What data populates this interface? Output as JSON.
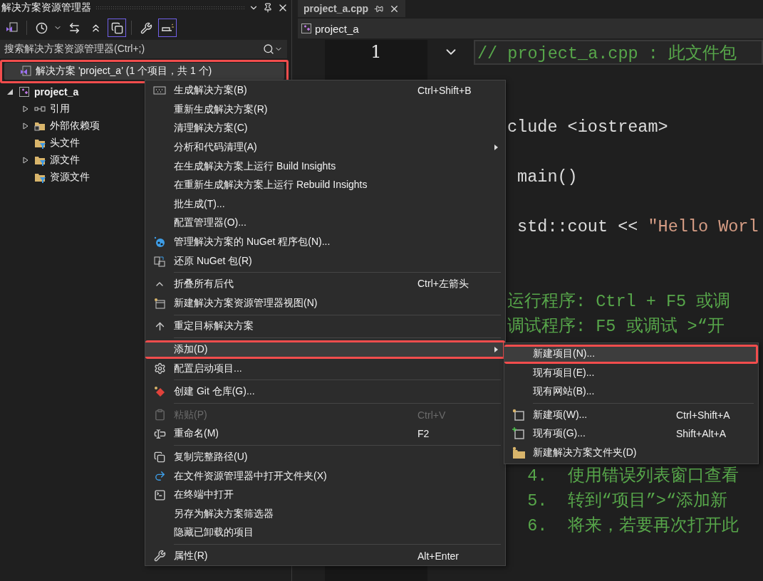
{
  "explorer": {
    "title": "解决方案资源管理器",
    "toolbar": [
      {
        "on": false
      },
      {
        "on": false
      },
      {
        "on": false
      },
      {
        "on": false
      },
      {
        "on": true
      },
      {
        "on": false
      },
      {
        "on": true
      }
    ],
    "search": {
      "placeholder": "搜索解决方案资源管理器(Ctrl+;)"
    },
    "tree": [
      {
        "label": "解决方案 'project_a' (1 个项目，共 1 个)",
        "kind": "solution",
        "selected": true,
        "highlighted": true,
        "children": [
          {
            "label": "project_a",
            "kind": "project",
            "selected": false,
            "highlighted": false,
            "expandable": true,
            "expanded": true,
            "children": [
              {
                "label": "引用",
                "kind": "references",
                "selected": false,
                "highlighted": false,
                "expandable": true,
                "expanded": false
              },
              {
                "label": "外部依赖项",
                "kind": "dependencies",
                "selected": false,
                "highlighted": false,
                "expandable": true,
                "expanded": false
              },
              {
                "label": "头文件",
                "kind": "filter",
                "selected": false,
                "highlighted": false,
                "expandable": false
              },
              {
                "label": "源文件",
                "kind": "filter",
                "selected": false,
                "highlighted": false,
                "expandable": true,
                "expanded": false
              },
              {
                "label": "资源文件",
                "kind": "filter",
                "selected": false,
                "highlighted": false,
                "expandable": false
              }
            ]
          }
        ]
      }
    ]
  },
  "editor": {
    "tab": {
      "label": "project_a.cpp",
      "selected": true
    },
    "nav": {
      "label": "project_a"
    },
    "line_numbers": [
      "1"
    ],
    "lines": [
      {
        "kind": "comment",
        "clipped_left": false,
        "segments": [
          {
            "kind": "comment",
            "text": "// project_a.cpp : 此文件包"
          }
        ]
      },
      {
        "kind": "covered"
      },
      {
        "kind": "blank"
      },
      {
        "kind": "code",
        "clipped_left": true,
        "segments": [
          {
            "kind": "plain",
            "text": "clude <iostream>"
          }
        ]
      },
      {
        "kind": "blank"
      },
      {
        "kind": "code",
        "clipped_left": true,
        "segments": [
          {
            "kind": "plain",
            "text": " main()"
          }
        ]
      },
      {
        "kind": "blank"
      },
      {
        "kind": "code",
        "clipped_left": true,
        "segments": [
          {
            "kind": "plain",
            "text": " std::cout << "
          },
          {
            "kind": "string",
            "text": "\"Hello Worl"
          }
        ]
      },
      {
        "kind": "blank"
      },
      {
        "kind": "blank"
      },
      {
        "kind": "code",
        "clipped_left": true,
        "segments": [
          {
            "kind": "comment",
            "text": "运行程序: Ctrl + F5 或调"
          }
        ]
      },
      {
        "kind": "code",
        "clipped_left": true,
        "segments": [
          {
            "kind": "comment",
            "text": "调试程序: F5 或调试 >“开"
          }
        ]
      },
      {
        "kind": "covered"
      },
      {
        "kind": "covered"
      },
      {
        "kind": "covered"
      },
      {
        "kind": "covered"
      },
      {
        "kind": "covered"
      },
      {
        "kind": "code",
        "clipped_left": true,
        "segments": [
          {
            "kind": "comment",
            "text": "  4.  使用错误列表窗口查看"
          }
        ]
      },
      {
        "kind": "code",
        "clipped_left": true,
        "segments": [
          {
            "kind": "comment",
            "text": "  5.  转到“项目”>“添加新"
          }
        ]
      },
      {
        "kind": "code",
        "clipped_left": true,
        "segments": [
          {
            "kind": "comment",
            "text": "  6.  将来，若要再次打开此"
          }
        ]
      }
    ]
  },
  "context_menu": {
    "items": [
      {
        "kind": "item",
        "label": "生成解决方案(B)",
        "shortcut": "Ctrl+Shift+B",
        "submenu": false,
        "disabled": false,
        "selected": false,
        "highlighted": false
      },
      {
        "kind": "item",
        "label": "重新生成解决方案(R)",
        "submenu": false,
        "disabled": false,
        "selected": false,
        "highlighted": false
      },
      {
        "kind": "item",
        "label": "清理解决方案(C)",
        "submenu": false,
        "disabled": false,
        "selected": false,
        "highlighted": false
      },
      {
        "kind": "item",
        "label": "分析和代码清理(A)",
        "submenu": true,
        "disabled": false,
        "selected": false,
        "highlighted": false
      },
      {
        "kind": "item",
        "label": "在生成解决方案上运行 Build Insights",
        "submenu": false,
        "disabled": false,
        "selected": false,
        "highlighted": false
      },
      {
        "kind": "item",
        "label": "在重新生成解决方案上运行 Rebuild Insights",
        "submenu": false,
        "disabled": false,
        "selected": false,
        "highlighted": false
      },
      {
        "kind": "item",
        "label": "批生成(T)...",
        "submenu": false,
        "disabled": false,
        "selected": false,
        "highlighted": false
      },
      {
        "kind": "item",
        "label": "配置管理器(O)...",
        "submenu": false,
        "disabled": false,
        "selected": false,
        "highlighted": false
      },
      {
        "kind": "item",
        "label": "管理解决方案的 NuGet 程序包(N)...",
        "submenu": false,
        "disabled": false,
        "selected": false,
        "highlighted": false
      },
      {
        "kind": "item",
        "label": "还原 NuGet 包(R)",
        "submenu": false,
        "disabled": false,
        "selected": false,
        "highlighted": false
      },
      {
        "kind": "separator"
      },
      {
        "kind": "item",
        "label": "折叠所有后代",
        "shortcut": "Ctrl+左箭头",
        "submenu": false,
        "disabled": false,
        "selected": false,
        "highlighted": false
      },
      {
        "kind": "item",
        "label": "新建解决方案资源管理器视图(N)",
        "submenu": false,
        "disabled": false,
        "selected": false,
        "highlighted": false
      },
      {
        "kind": "separator"
      },
      {
        "kind": "item",
        "label": "重定目标解决方案",
        "submenu": false,
        "disabled": false,
        "selected": false,
        "highlighted": false
      },
      {
        "kind": "separator"
      },
      {
        "kind": "item",
        "label": "添加(D)",
        "submenu": true,
        "disabled": false,
        "selected": true,
        "highlighted": true
      },
      {
        "kind": "item",
        "label": "配置启动项目...",
        "submenu": false,
        "disabled": false,
        "selected": false,
        "highlighted": false
      },
      {
        "kind": "separator"
      },
      {
        "kind": "item",
        "label": "创建 Git 仓库(G)...",
        "submenu": false,
        "disabled": false,
        "selected": false,
        "highlighted": false
      },
      {
        "kind": "separator"
      },
      {
        "kind": "item",
        "label": "粘贴(P)",
        "shortcut": "Ctrl+V",
        "submenu": false,
        "disabled": true,
        "selected": false,
        "highlighted": false
      },
      {
        "kind": "item",
        "label": "重命名(M)",
        "shortcut": "F2",
        "submenu": false,
        "disabled": false,
        "selected": false,
        "highlighted": false
      },
      {
        "kind": "separator"
      },
      {
        "kind": "item",
        "label": "复制完整路径(U)",
        "submenu": false,
        "disabled": false,
        "selected": false,
        "highlighted": false
      },
      {
        "kind": "item",
        "label": "在文件资源管理器中打开文件夹(X)",
        "submenu": false,
        "disabled": false,
        "selected": false,
        "highlighted": false
      },
      {
        "kind": "item",
        "label": "在终端中打开",
        "submenu": false,
        "disabled": false,
        "selected": false,
        "highlighted": false
      },
      {
        "kind": "item",
        "label": "另存为解决方案筛选器",
        "submenu": false,
        "disabled": false,
        "selected": false,
        "highlighted": false
      },
      {
        "kind": "item",
        "label": "隐藏已卸载的项目",
        "submenu": false,
        "disabled": false,
        "selected": false,
        "highlighted": false
      },
      {
        "kind": "separator"
      },
      {
        "kind": "item",
        "label": "属性(R)",
        "shortcut": "Alt+Enter",
        "submenu": false,
        "disabled": false,
        "selected": false,
        "highlighted": false
      }
    ]
  },
  "submenu": {
    "items": [
      {
        "kind": "item",
        "label": "新建项目(N)...",
        "disabled": false,
        "selected": true,
        "highlighted": true
      },
      {
        "kind": "item",
        "label": "现有项目(E)...",
        "disabled": false,
        "selected": false,
        "highlighted": false
      },
      {
        "kind": "item",
        "label": "现有网站(B)...",
        "disabled": false,
        "selected": false,
        "highlighted": false
      },
      {
        "kind": "separator"
      },
      {
        "kind": "item",
        "label": "新建项(W)...",
        "shortcut": "Ctrl+Shift+A",
        "disabled": false,
        "selected": false,
        "highlighted": false
      },
      {
        "kind": "item",
        "label": "现有项(G)...",
        "shortcut": "Shift+Alt+A",
        "disabled": false,
        "selected": false,
        "highlighted": false
      },
      {
        "kind": "item",
        "label": "新建解决方案文件夹(D)",
        "disabled": false,
        "selected": false,
        "highlighted": false
      }
    ]
  }
}
